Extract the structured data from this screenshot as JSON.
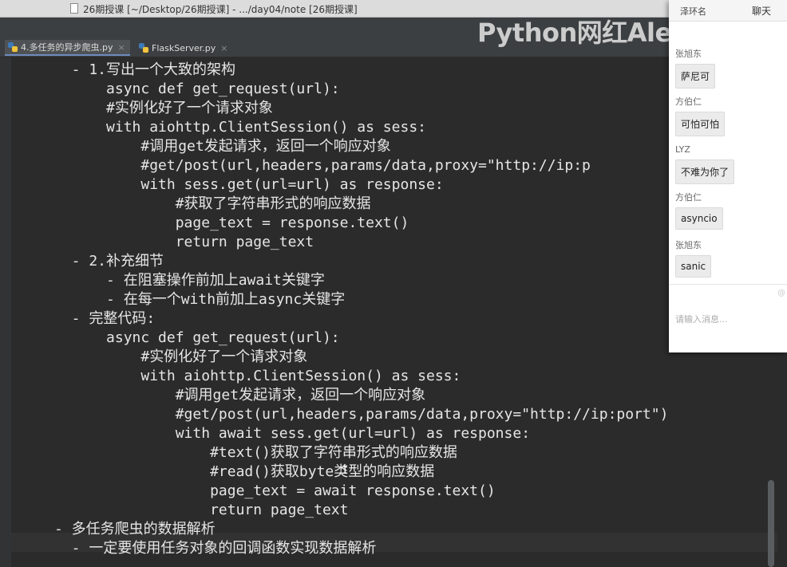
{
  "window": {
    "title": "26期授课 [~/Desktop/26期授课] - .../day04/note [26期授课]"
  },
  "watermark": "Python网红Alex",
  "tabs": [
    {
      "label": "4.多任务的异步爬虫.py",
      "close": "×"
    },
    {
      "label": "FlaskServer.py",
      "close": "×"
    }
  ],
  "code_lines": [
    "  - 1.写出一个大致的架构",
    "      async def get_request(url):",
    "      #实例化好了一个请求对象",
    "      with aiohttp.ClientSession() as sess:",
    "          #调用get发起请求，返回一个响应对象",
    "          #get/post(url,headers,params/data,proxy=\"http://ip:p",
    "          with sess.get(url=url) as response:",
    "              #获取了字符串形式的响应数据",
    "              page_text = response.text()",
    "              return page_text",
    "  - 2.补充细节",
    "      - 在阻塞操作前加上await关键字",
    "      - 在每一个with前加上async关键字",
    "  - 完整代码:",
    "      async def get_request(url):",
    "          #实例化好了一个请求对象",
    "          with aiohttp.ClientSession() as sess:",
    "              #调用get发起请求，返回一个响应对象",
    "              #get/post(url,headers,params/data,proxy=\"http://ip:port\")",
    "              with await sess.get(url=url) as response:",
    "                  #text()获取了字符串形式的响应数据",
    "                  #read()获取byte类型的响应数据",
    "                  page_text = await response.text()",
    "                  return page_text",
    "- 多任务爬虫的数据解析",
    "  - 一定要使用任务对象的回调函数实现数据解析"
  ],
  "chat": {
    "title": "聊天",
    "top_partial": "泽环名",
    "messages": [
      {
        "sender": "张旭东",
        "text": "萨尼可"
      },
      {
        "sender": "方伯仁",
        "text": "可怕可怕"
      },
      {
        "sender": "LYZ",
        "text": "不难为你了"
      },
      {
        "sender": "方伯仁",
        "text": "asyncio"
      },
      {
        "sender": "张旭东",
        "text": "sanic"
      }
    ],
    "input_placeholder": "请输入消息...",
    "edge_mark": "@"
  },
  "colors": {
    "editor_bg": "#2b2b2b",
    "code_text": "#e6e6e6",
    "chat_bg": "#ffffff"
  }
}
